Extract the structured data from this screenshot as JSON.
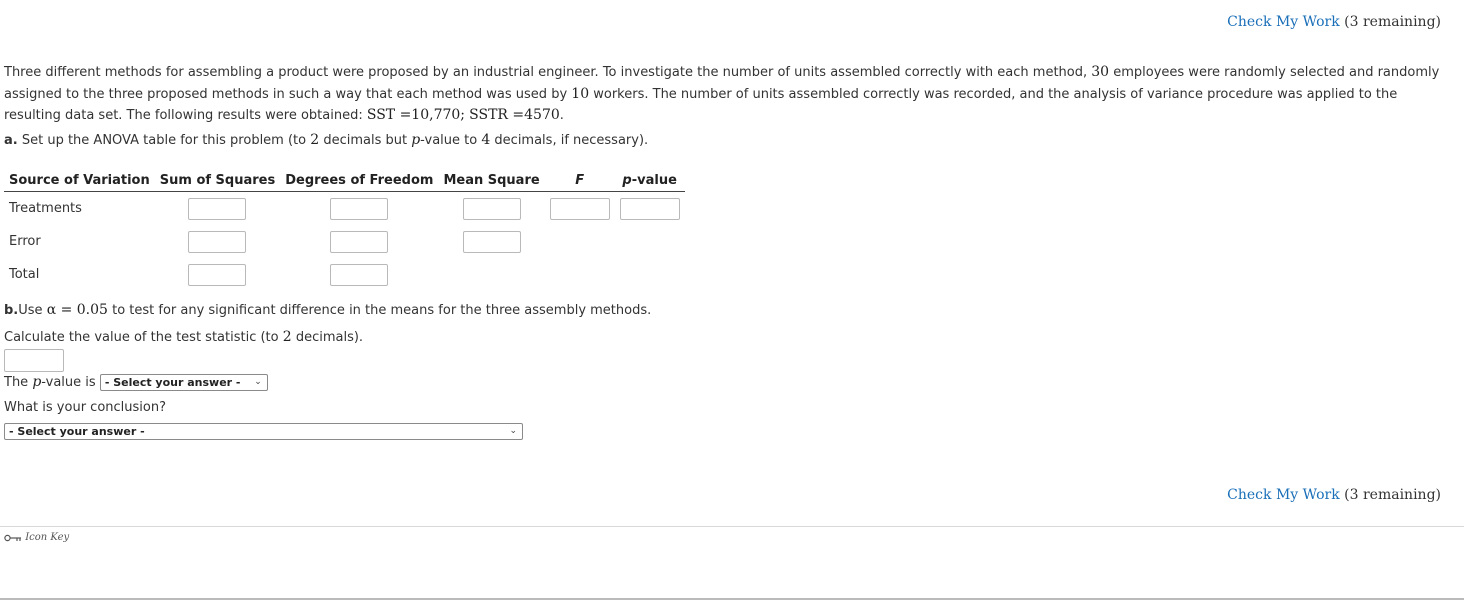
{
  "check_my_work": {
    "link_label": "Check My Work",
    "remaining_text": "(3 remaining)"
  },
  "intro": {
    "part1": "Three different methods for assembling a product were proposed by an industrial engineer. To investigate the number of units assembled correctly with each method,",
    "employees": "30",
    "part2": "employees were randomly selected and randomly assigned to the three proposed methods in such a way that each method was used by",
    "workers": "10",
    "part3": "workers. The number of units assembled correctly was recorded, and the analysis of variance procedure was applied to the resulting data set. The following results were obtained:",
    "sst": "SST =10,770",
    "sep": ";",
    "sstr": "SSTR =4570",
    "end": "."
  },
  "part_a": {
    "prefix": "a.",
    "text1": "Set up the ANOVA table for this problem (to",
    "num1": "2",
    "text2": "decimals but",
    "pitalic": "p",
    "text3": "-value to",
    "num2": "4",
    "text4": "decimals, if necessary)."
  },
  "anova": {
    "headers": {
      "source": "Source of Variation",
      "ss": "Sum of Squares",
      "df": "Degrees of Freedom",
      "ms": "Mean Square",
      "f": "F",
      "p_italic": "p",
      "p_rest": "-value"
    },
    "rows": [
      {
        "label": "Treatments"
      },
      {
        "label": "Error"
      },
      {
        "label": "Total"
      }
    ]
  },
  "part_b": {
    "prefix": "b.",
    "text1": "Use",
    "alpha": "α = 0.05",
    "text2": "to test for any significant difference in the means for the three assembly methods.",
    "calc1": "Calculate the value of the test statistic (to",
    "calc_num": "2",
    "calc2": "decimals).",
    "pvalue_text1": "The",
    "pvalue_p": "p",
    "pvalue_text2": "-value is",
    "pvalue_select": "- Select your answer -",
    "conclusion_q": "What is your conclusion?",
    "conclusion_select": "- Select your answer -"
  },
  "footer": {
    "icon_key": "Icon Key",
    "icon_name": "key-icon"
  }
}
